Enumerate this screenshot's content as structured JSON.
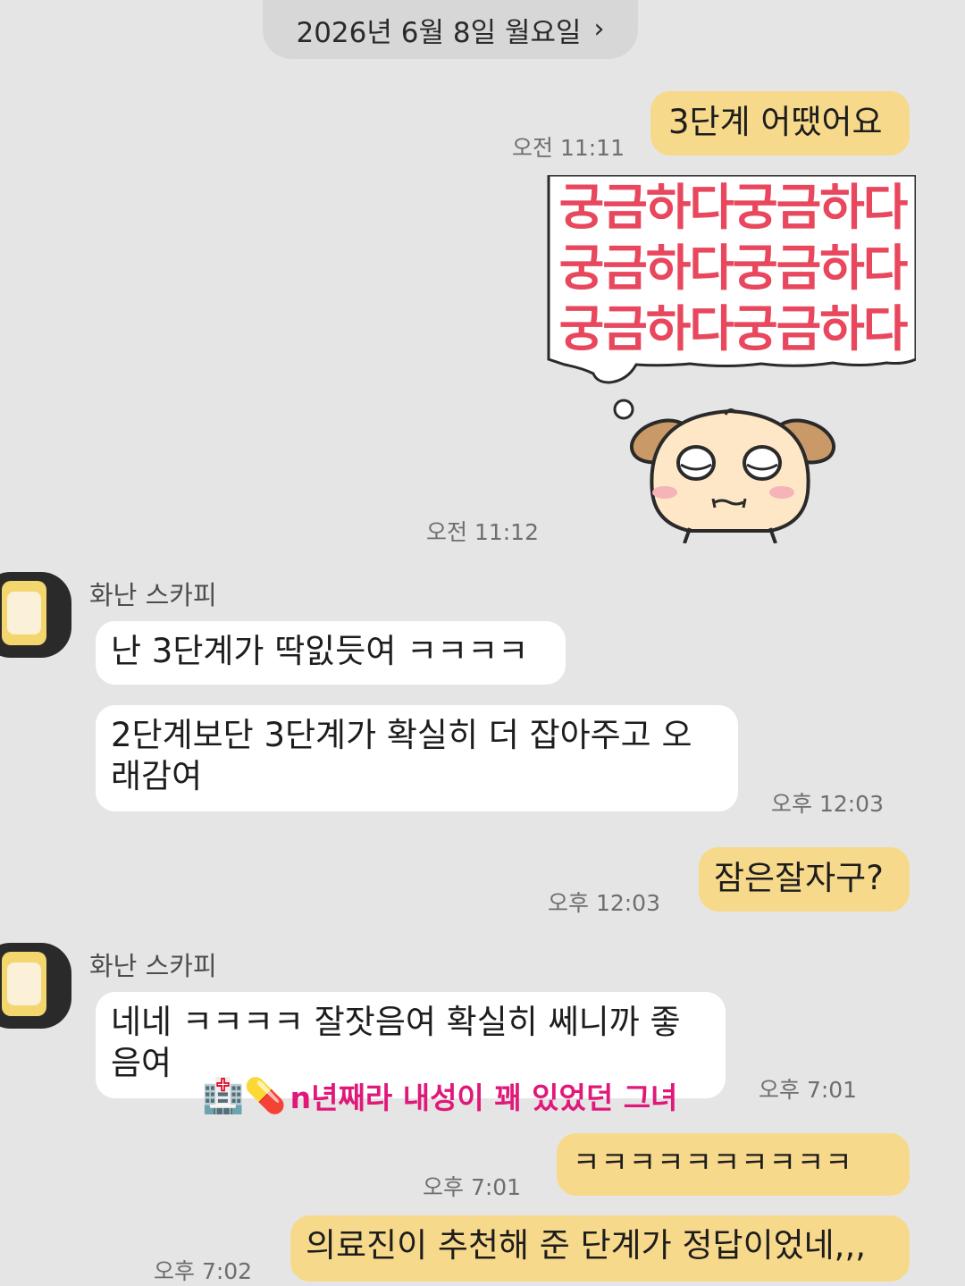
{
  "date_header": {
    "label": "2026년 6월 8일 월요일",
    "chevron": "›"
  },
  "messages": {
    "m1": {
      "text": "3단계 어땠어요",
      "time": "오전 11:11"
    },
    "sticker": {
      "text": "궁금하다궁금하다\n궁금하다궁금하다\n궁금하다궁금하다",
      "time": "오전 11:12"
    },
    "sender1": "화난 스카피",
    "m2": {
      "text": "난 3단계가 딱잀듯여 ㅋㅋㅋㅋ"
    },
    "m3": {
      "line1": "2단계보단 3단계가 확실히 더 잡아주고 오",
      "line2": "래감여",
      "time": "오후 12:03"
    },
    "m4": {
      "text": "잠은잘자구?",
      "time": "오후 12:03"
    },
    "sender2": "화난 스카피",
    "m5": {
      "line1": "네네 ㅋㅋㅋㅋ 잘잣음여 확실히 쎄니까 좋",
      "line2": "음여",
      "time": "오후 7:01"
    },
    "m6": {
      "text": "ㅋㅋㅋㅋㅋㅋㅋㅋㅋㅋ",
      "time": "오후 7:01"
    },
    "m7": {
      "text": "의료진이 추천해 준 단계가 정답이었네,,,",
      "time": "오후 7:02"
    }
  },
  "overlay_caption": {
    "emoji": "🏥💊",
    "text": "n년째라 내성이 꽤 있었던 그녀"
  },
  "colors": {
    "my_bubble": "#f7d98b",
    "their_bubble": "#ffffff",
    "background": "#e5e5e5",
    "sticker_text": "#e8475d",
    "caption": "#e0187a"
  }
}
